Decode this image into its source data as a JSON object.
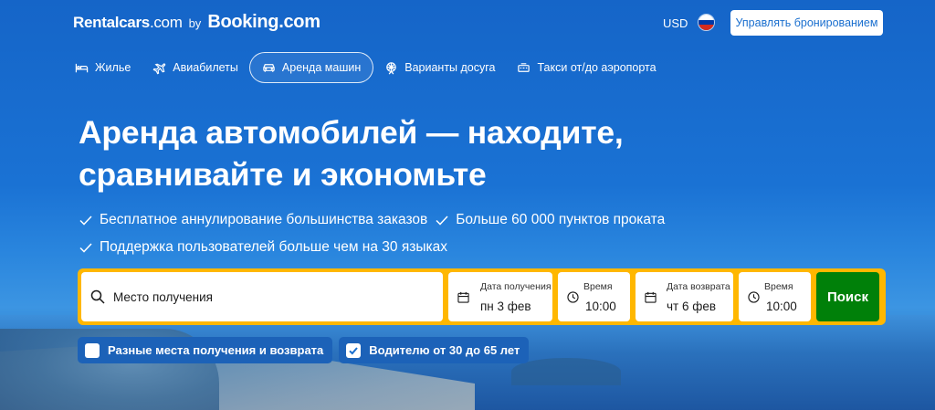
{
  "header": {
    "brand_rentalcars": "Rentalcars",
    "brand_rentalcars_com": ".com",
    "brand_by": "by",
    "brand_booking": "Booking",
    "brand_booking_com": ".com",
    "currency": "USD",
    "manage_label": "Управлять бронированием"
  },
  "nav": {
    "items": [
      {
        "label": "Жилье",
        "icon": "bed-icon"
      },
      {
        "label": "Авиабилеты",
        "icon": "plane-icon"
      },
      {
        "label": "Аренда машин",
        "icon": "car-icon",
        "active": true
      },
      {
        "label": "Варианты досуга",
        "icon": "attractions-icon"
      },
      {
        "label": "Такси от/до аэропорта",
        "icon": "taxi-icon"
      }
    ]
  },
  "hero": {
    "title_line1": "Аренда автомобилей — находите,",
    "title_line2": "сравнивайте и экономьте",
    "bullets": [
      "Бесплатное аннулирование большинства заказов",
      "Больше 60 000 пунктов проката",
      "Поддержка пользователей больше чем на 30 языках"
    ]
  },
  "search": {
    "location_placeholder": "Место получения",
    "pickup_date_label": "Дата получения",
    "pickup_date_value": "пн 3 фев",
    "pickup_time_label": "Время",
    "pickup_time_value": "10:00",
    "return_date_label": "Дата возврата",
    "return_date_value": "чт 6 фев",
    "return_time_label": "Время",
    "return_time_value": "10:00",
    "button_label": "Поиск"
  },
  "options": {
    "different_return": {
      "label": "Разные места получения и возврата",
      "checked": false
    },
    "driver_age": {
      "label": "Водителю от 30 до 65 лет",
      "checked": true
    }
  },
  "colors": {
    "background": "#1a6fcf",
    "search_border": "#ffb700",
    "search_button": "#008009",
    "link_blue": "#1a6fcf"
  }
}
